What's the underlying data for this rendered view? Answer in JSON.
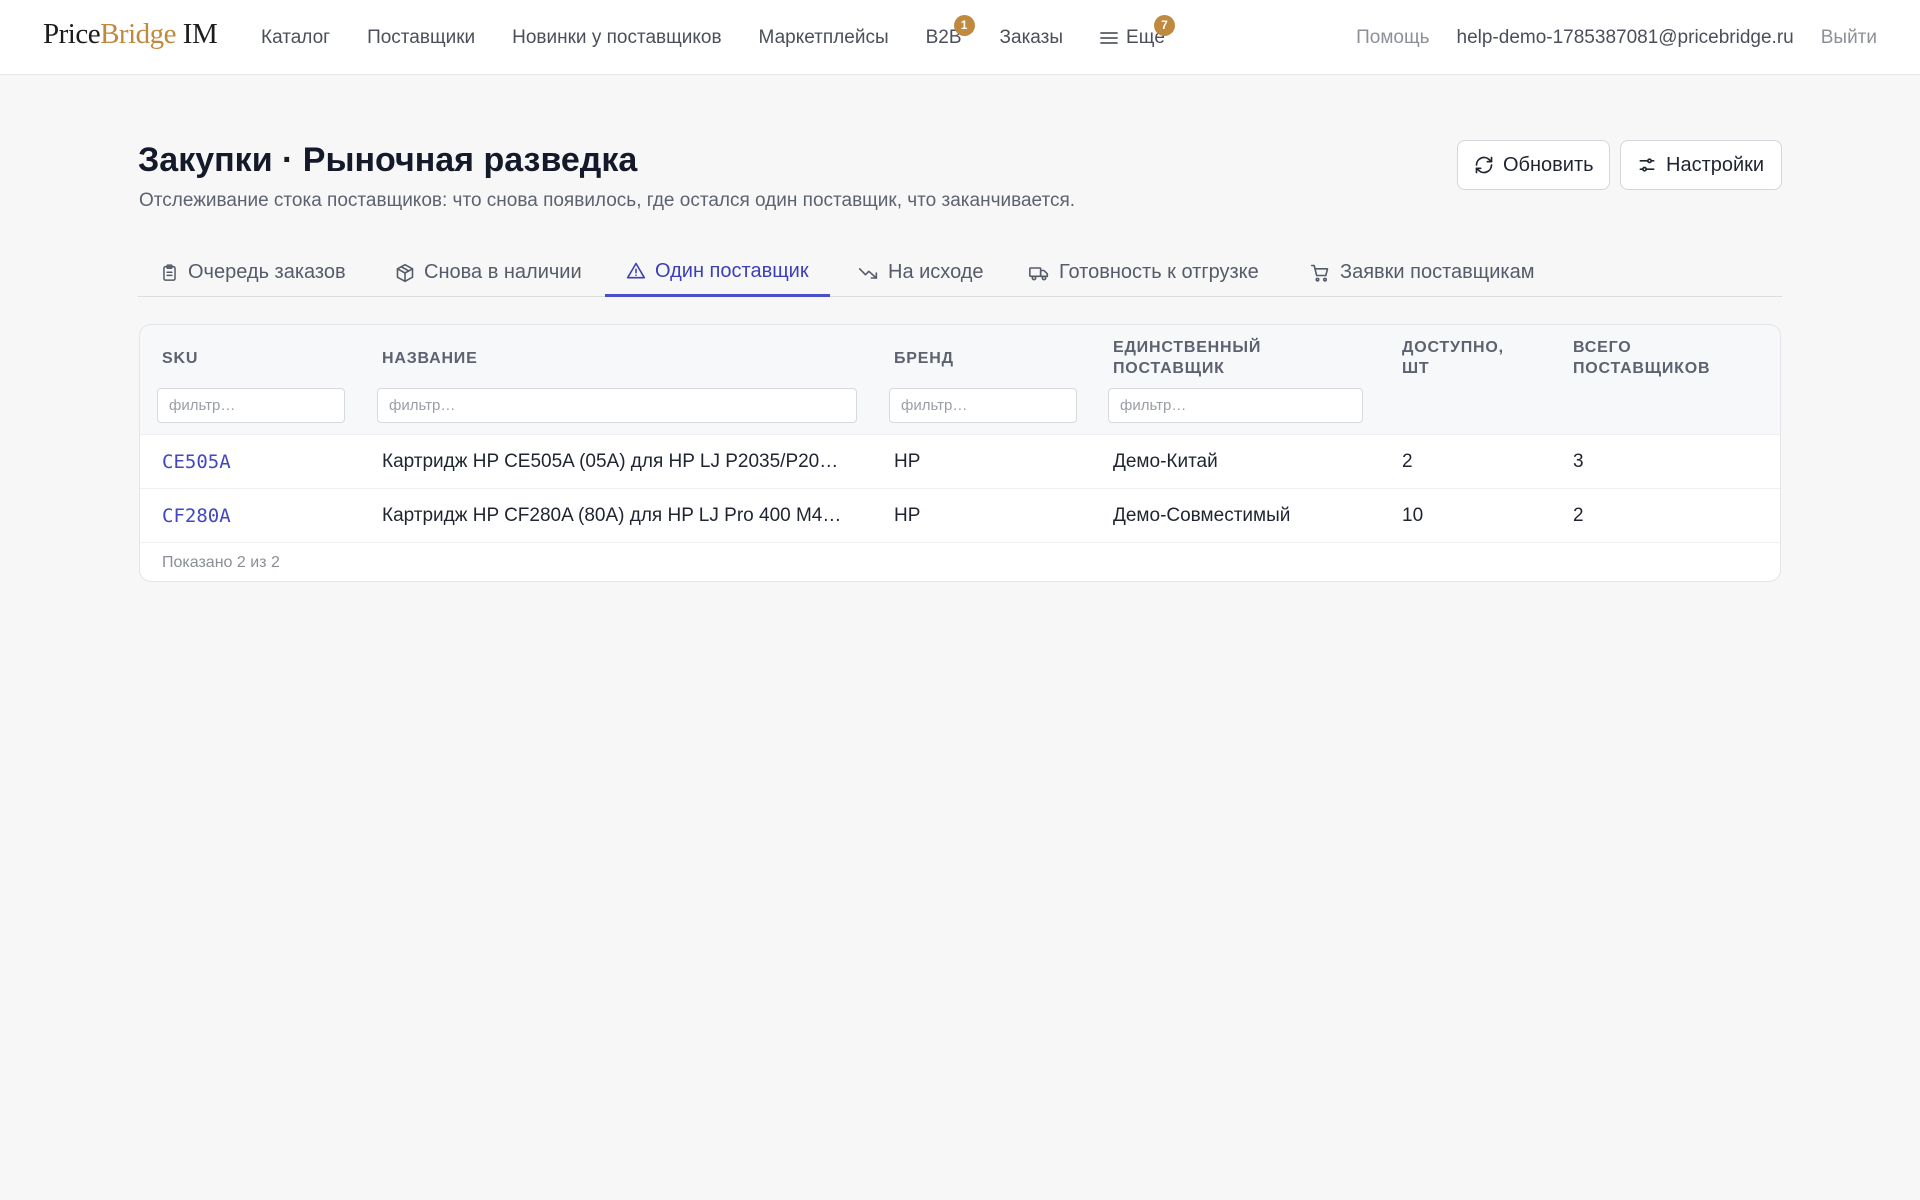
{
  "brand": {
    "part1": "Price",
    "part2": "Bridge",
    "part3": " IM"
  },
  "nav": {
    "items": [
      {
        "label": "Каталог",
        "badge": null
      },
      {
        "label": "Поставщики",
        "badge": null
      },
      {
        "label": "Новинки у поставщиков",
        "badge": null
      },
      {
        "label": "Маркетплейсы",
        "badge": null
      },
      {
        "label": "B2B",
        "badge": "1"
      },
      {
        "label": "Заказы",
        "badge": null
      },
      {
        "label": "Ещё",
        "badge": "7"
      }
    ],
    "help": "Помощь",
    "email": "help-demo-1785387081@pricebridge.ru",
    "logout": "Выйти"
  },
  "header": {
    "title": "Закупки · Рыночная разведка",
    "subtitle": "Отслеживание стока поставщиков: что снова появилось, где остался один поставщик, что заканчивается.",
    "refresh_label": "Обновить",
    "settings_label": "Настройки"
  },
  "tabs": [
    {
      "label": "Очередь заказов",
      "icon": "clipboard-icon"
    },
    {
      "label": "Снова в наличии",
      "icon": "package-icon"
    },
    {
      "label": "Один поставщик",
      "icon": "warning-icon",
      "active": true
    },
    {
      "label": "На исходе",
      "icon": "trending-down-icon"
    },
    {
      "label": "Готовность к отгрузке",
      "icon": "truck-icon"
    },
    {
      "label": "Заявки поставщикам",
      "icon": "cart-icon"
    }
  ],
  "table": {
    "columns": {
      "sku": "SKU",
      "name": "Название",
      "brand": "Бренд",
      "supplier_1": "Единственный",
      "supplier_2": "поставщик",
      "available_1": "Доступно,",
      "available_2": "шт",
      "total_1": "Всего",
      "total_2": "поставщиков"
    },
    "filter_placeholder": "фильтр…",
    "rows": [
      {
        "sku": "CE505A",
        "name": "Картридж HP CE505A (05A) для HP LJ P2035/P20…",
        "brand": "HP",
        "supplier": "Демо-Китай",
        "available": "2",
        "total": "3"
      },
      {
        "sku": "CF280A",
        "name": "Картридж HP CF280A (80A) для HP LJ Pro 400 M4…",
        "brand": "HP",
        "supplier": "Демо-Совместимый",
        "available": "10",
        "total": "2"
      }
    ],
    "footer": "Показано 2 из 2"
  },
  "colors": {
    "accent": "#4b4fc9",
    "badge": "#c08a3e",
    "background": "#f7f7f7"
  }
}
